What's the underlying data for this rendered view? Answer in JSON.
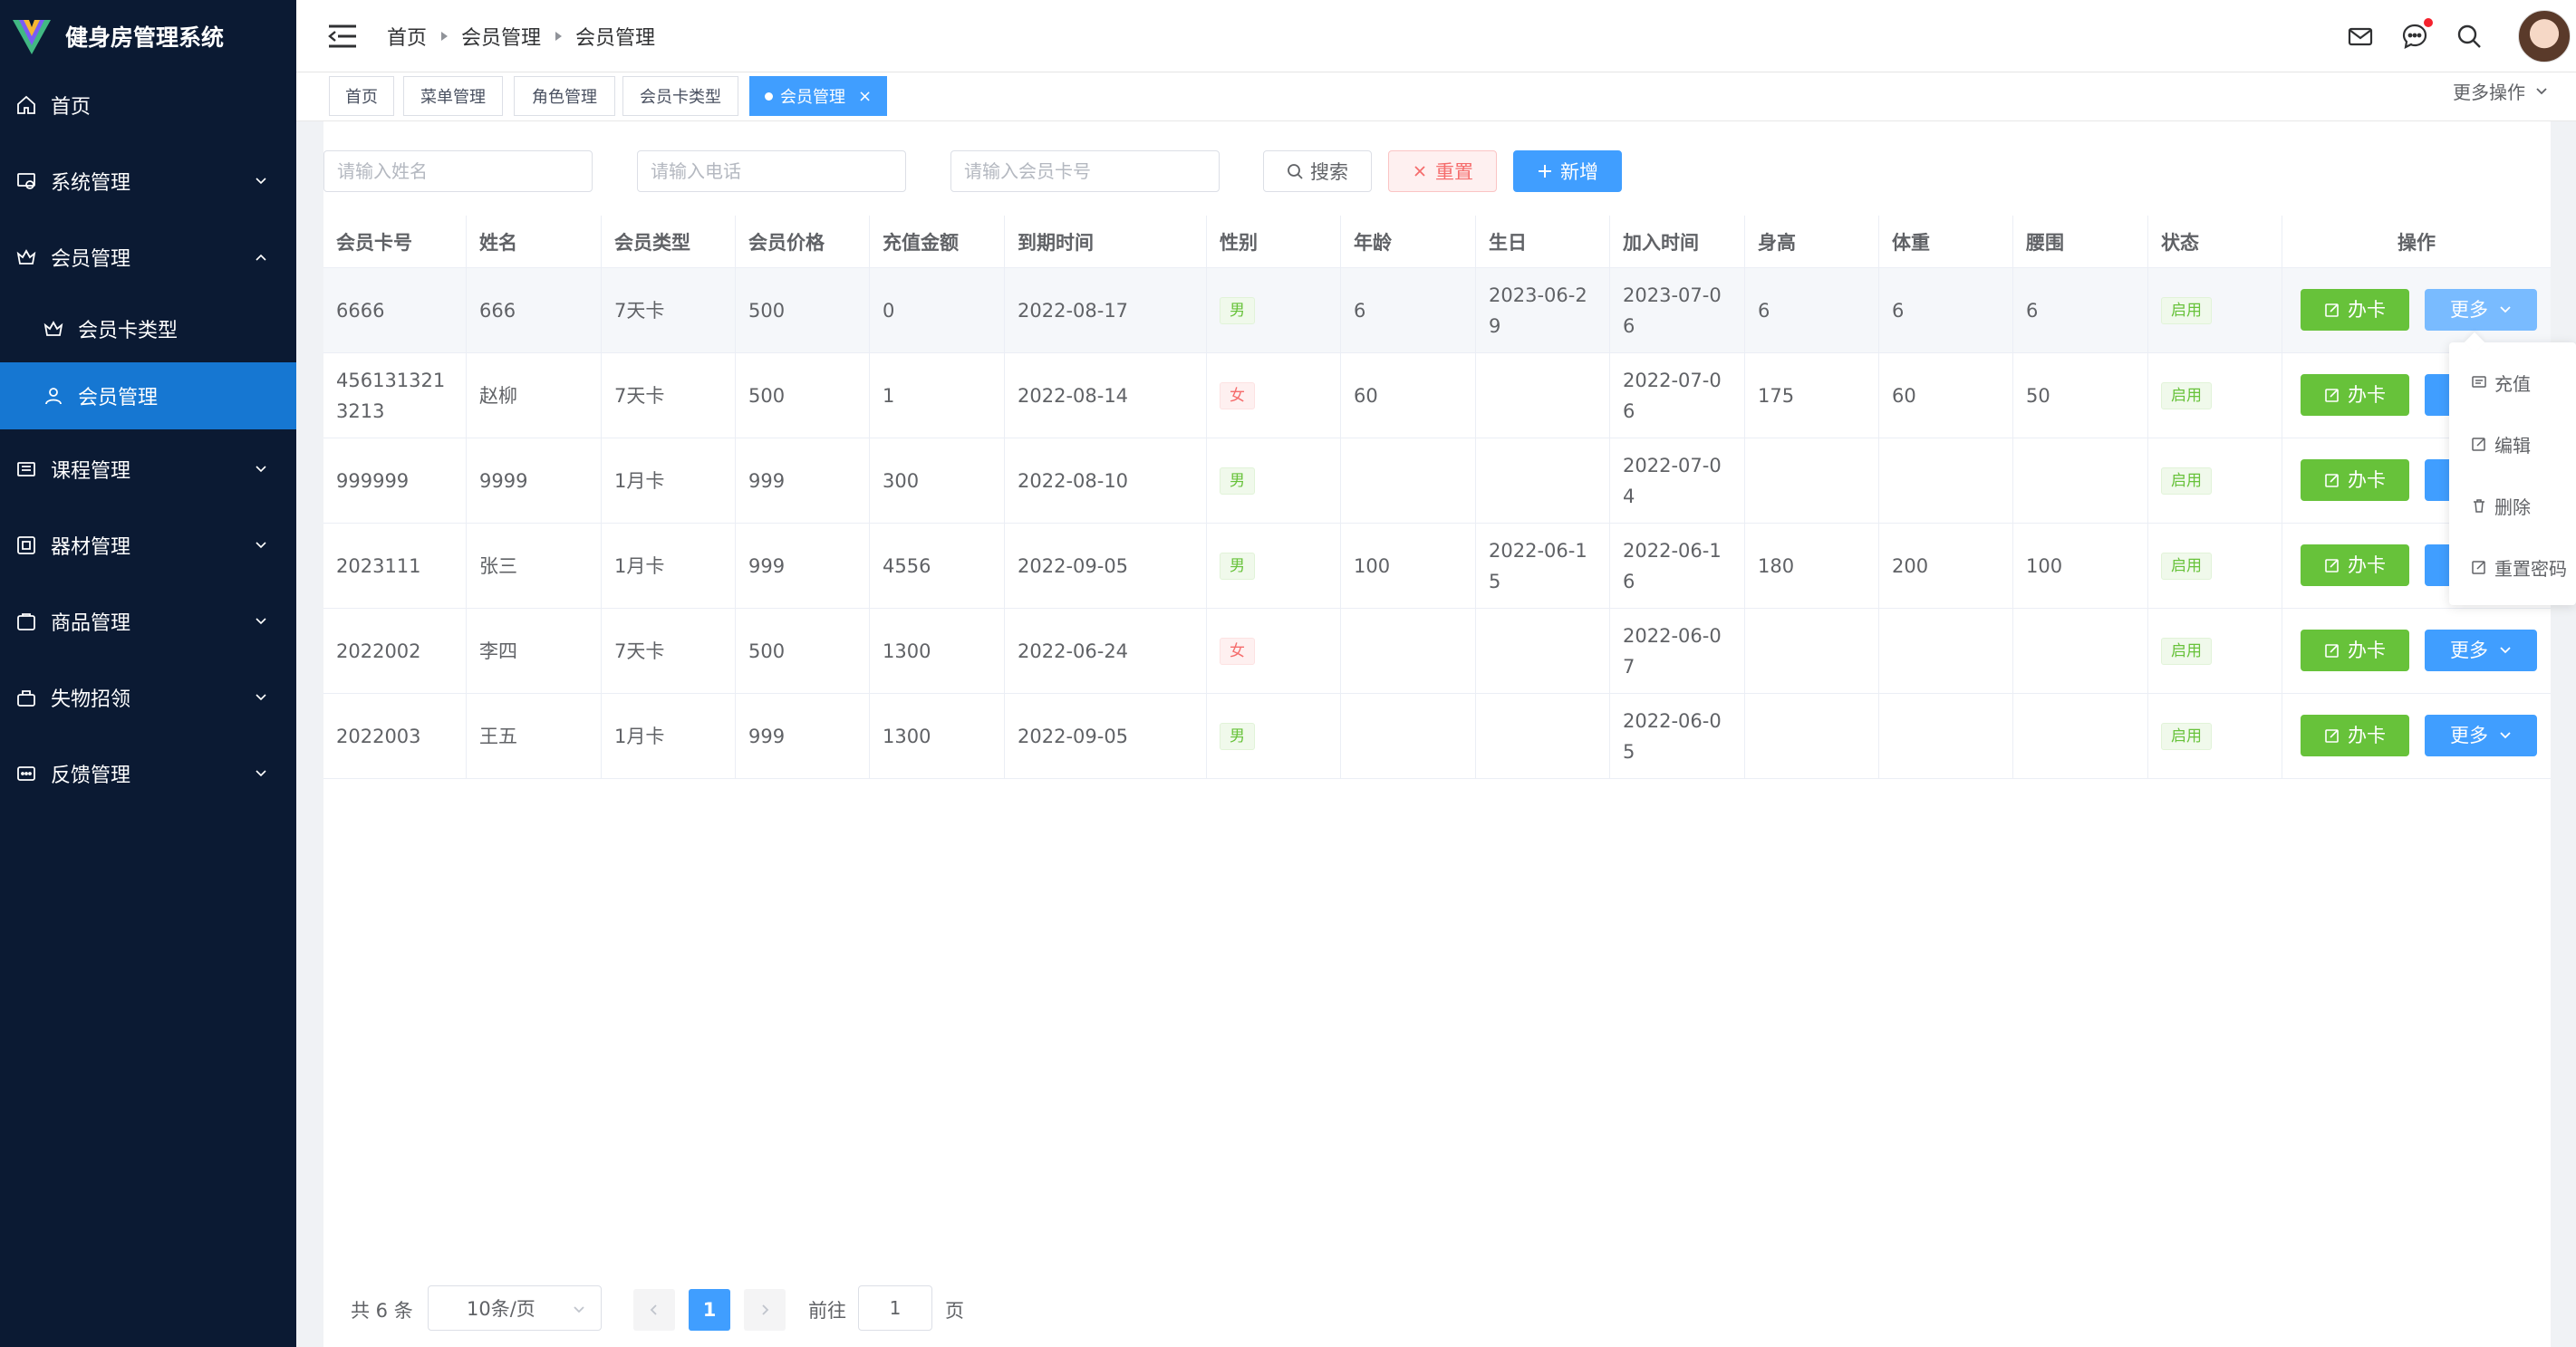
{
  "app": {
    "title": "健身房管理系统"
  },
  "sidebar": {
    "items": [
      {
        "label": "首页",
        "icon": "home-icon"
      },
      {
        "label": "系统管理",
        "icon": "system-icon"
      },
      {
        "label": "会员管理",
        "icon": "crown-icon"
      },
      {
        "label": "会员卡类型",
        "icon": "crown-icon"
      },
      {
        "label": "会员管理",
        "icon": "user-icon"
      },
      {
        "label": "课程管理",
        "icon": "course-icon"
      },
      {
        "label": "器材管理",
        "icon": "equipment-icon"
      },
      {
        "label": "商品管理",
        "icon": "goods-icon"
      },
      {
        "label": "失物招领",
        "icon": "lost-found-icon"
      },
      {
        "label": "反馈管理",
        "icon": "feedback-icon"
      }
    ]
  },
  "breadcrumb": [
    "首页",
    "会员管理",
    "会员管理"
  ],
  "tags": [
    "首页",
    "菜单管理",
    "角色管理",
    "会员卡类型",
    "会员管理"
  ],
  "more_ops": "更多操作",
  "search": {
    "name_placeholder": "请输入姓名",
    "phone_placeholder": "请输入电话",
    "card_placeholder": "请输入会员卡号",
    "search_label": "搜索",
    "reset_label": "重置",
    "add_label": "新增"
  },
  "table": {
    "headers": [
      "会员卡号",
      "姓名",
      "会员类型",
      "会员价格",
      "充值金额",
      "到期时间",
      "性别",
      "年龄",
      "生日",
      "加入时间",
      "身高",
      "体重",
      "腰围",
      "状态",
      "操作"
    ],
    "rows": [
      [
        "6666",
        "666",
        "7天卡",
        "500",
        "0",
        "2022-08-17",
        "男",
        "6",
        "2023-06-29",
        "2023-07-06",
        "6",
        "6",
        "6",
        "启用"
      ],
      [
        "4561313213213",
        "赵柳",
        "7天卡",
        "500",
        "1",
        "2022-08-14",
        "女",
        "60",
        "",
        "2022-07-06",
        "175",
        "60",
        "50",
        "启用"
      ],
      [
        "999999",
        "9999",
        "1月卡",
        "999",
        "300",
        "2022-08-10",
        "男",
        "",
        "",
        "2022-07-04",
        "",
        "",
        "",
        "启用"
      ],
      [
        "2023111",
        "张三",
        "1月卡",
        "999",
        "4556",
        "2022-09-05",
        "男",
        "100",
        "2022-06-15",
        "2022-06-16",
        "180",
        "200",
        "100",
        "启用"
      ],
      [
        "2022002",
        "李四",
        "7天卡",
        "500",
        "1300",
        "2022-06-24",
        "女",
        "",
        "",
        "2022-06-07",
        "",
        "",
        "",
        "启用"
      ],
      [
        "2022003",
        "王五",
        "1月卡",
        "999",
        "1300",
        "2022-09-05",
        "男",
        "",
        "",
        "2022-06-05",
        "",
        "",
        "",
        "启用"
      ]
    ],
    "card_btn_label": "办卡",
    "more_btn_label": "更多"
  },
  "dropdown": {
    "items": [
      "充值",
      "编辑",
      "删除",
      "重置密码"
    ]
  },
  "pagination": {
    "total_label": "共 6 条",
    "page_size": "10条/页",
    "current_page": "1",
    "goto_label": "前往",
    "goto_value": "1",
    "page_suffix": "页"
  },
  "colors": {
    "sidebar_bg": "#0b1a33",
    "active_menu": "#1677d2",
    "primary": "#409eff",
    "success": "#67c23a",
    "danger": "#f56c6c"
  }
}
